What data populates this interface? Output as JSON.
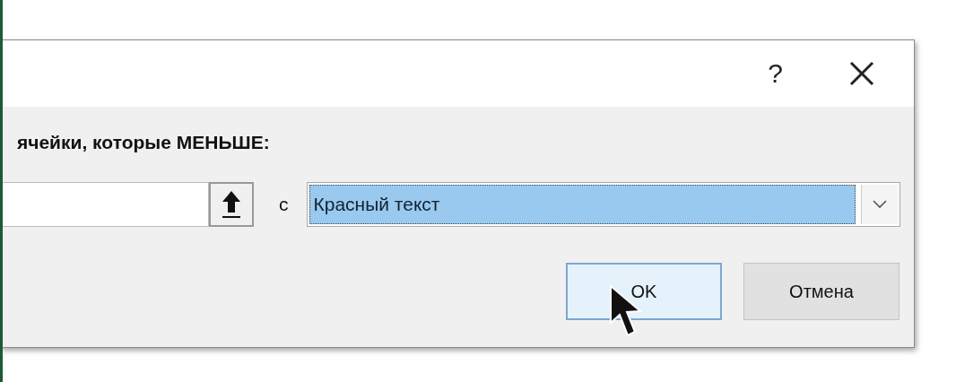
{
  "dialog": {
    "help_button": "?",
    "prompt": "ячейки, которые МЕНЬШЕ:",
    "connector": "с",
    "format_dropdown": {
      "value": "Красный текст",
      "text_selected": true
    },
    "buttons": [
      {
        "label": "OK",
        "focused": true
      },
      {
        "label": "Отмена",
        "focused": false
      }
    ]
  }
}
